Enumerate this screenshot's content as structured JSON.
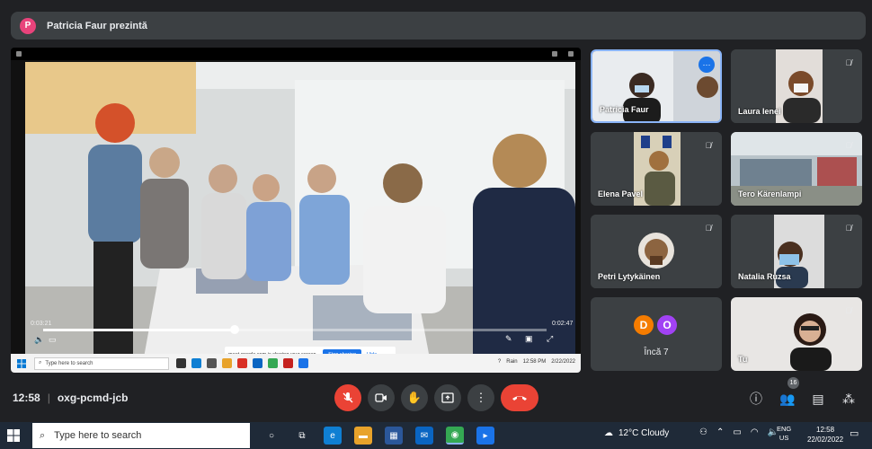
{
  "presenter": {
    "avatar_letter": "P",
    "text": "Patricia Faur prezintă"
  },
  "video": {
    "time_current": "0:03:21",
    "time_total": "0:02:47",
    "progress": 0.38,
    "share_banner_text": "meet.google.com is sharing your screen.",
    "stop_label": "Stop sharing",
    "hide_label": "Hide"
  },
  "inner_taskbar": {
    "search_placeholder": "Type here to search",
    "tray_text": "Rain",
    "time": "12:58 PM",
    "date": "2/22/2022"
  },
  "tiles": [
    {
      "name": "Patricia Faur",
      "speaking": true
    },
    {
      "name": "Laura Ienei",
      "muted": true
    },
    {
      "name": "Elena Pavel",
      "muted": true
    },
    {
      "name": "Tero Kärenlampi",
      "muted": true
    },
    {
      "name": "Petri Lytykäinen",
      "muted": true
    },
    {
      "name": "Natalia Ruzsa",
      "muted": true
    },
    {
      "name": "Încă 7",
      "avatars": [
        "D",
        "O"
      ]
    },
    {
      "name": "Tu",
      "muted": true
    }
  ],
  "meeting": {
    "time": "12:58",
    "separator": "|",
    "code": "oxg-pcmd-jcb"
  },
  "people_count": "16",
  "taskbar": {
    "search_placeholder": "Type here to search",
    "weather": "12°C  Cloudy",
    "lang_top": "ENG",
    "lang_bottom": "US",
    "clock_time": "12:58",
    "clock_date": "22/02/2022"
  },
  "colors": {
    "background": "#202124",
    "tile_bg": "#3c4043",
    "danger": "#ea4335",
    "accent": "#1a73e8",
    "avatar_d": "#f57c00",
    "avatar_o": "#a142f4"
  }
}
